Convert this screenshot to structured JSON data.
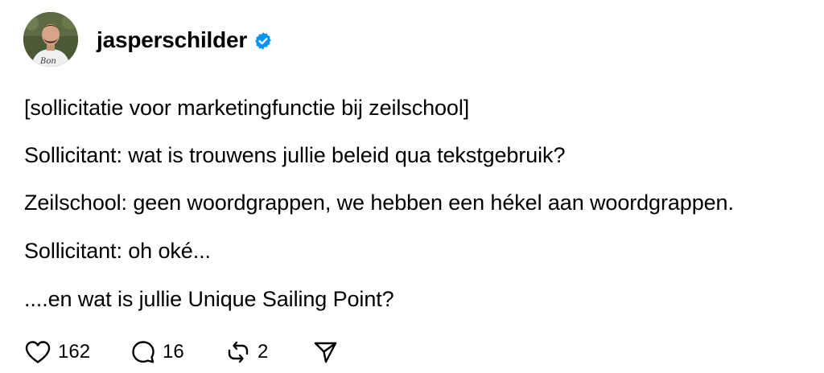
{
  "post": {
    "author": {
      "username": "jasperschilder",
      "verified": true,
      "avatar_icon": "profile-photo",
      "avatar_shirt_text": "Bon"
    },
    "lines": [
      "[sollicitatie voor marketingfunctie bij zeilschool]",
      "Sollicitant: wat is trouwens jullie beleid qua tekstgebruik?",
      "Zeilschool: geen woordgrappen, we hebben een hékel aan woordgrappen.",
      "Sollicitant: oh oké...",
      "....en wat is jullie Unique Sailing Point?"
    ],
    "actions": {
      "likes": "162",
      "replies": "16",
      "reposts": "2"
    }
  },
  "icons": {
    "like": "heart-icon",
    "reply": "speech-bubble-icon",
    "repost": "repost-arrows-icon",
    "share": "paper-plane-icon",
    "verified": "verified-badge-icon"
  },
  "colors": {
    "verified_badge": "#0095f6",
    "text": "#000000",
    "background": "#ffffff"
  }
}
